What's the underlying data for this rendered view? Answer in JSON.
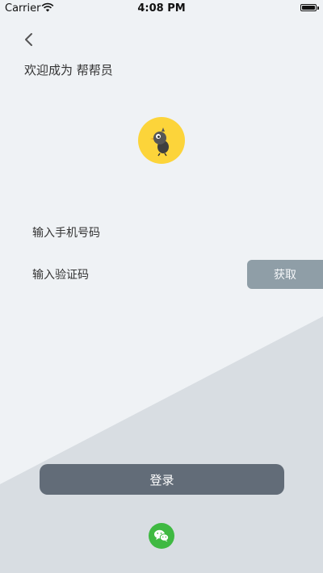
{
  "status_bar": {
    "carrier": "Carrier",
    "time": "4:08 PM"
  },
  "header": {
    "back_icon": "chevron-left-icon",
    "welcome_text": "欢迎成为 帮帮员"
  },
  "avatar": {
    "icon": "bird-mascot-icon"
  },
  "form": {
    "phone_placeholder": "输入手机号码",
    "code_placeholder": "输入验证码",
    "get_code_label": "获取"
  },
  "login": {
    "label": "登录"
  },
  "social": {
    "wechat_icon": "wechat-icon"
  },
  "colors": {
    "background": "#eff2f5",
    "background_lower": "#d8dde2",
    "get_button": "#8f9ea7",
    "login_button": "#626c78",
    "avatar": "#fcd43a",
    "wechat": "#3fb942"
  }
}
